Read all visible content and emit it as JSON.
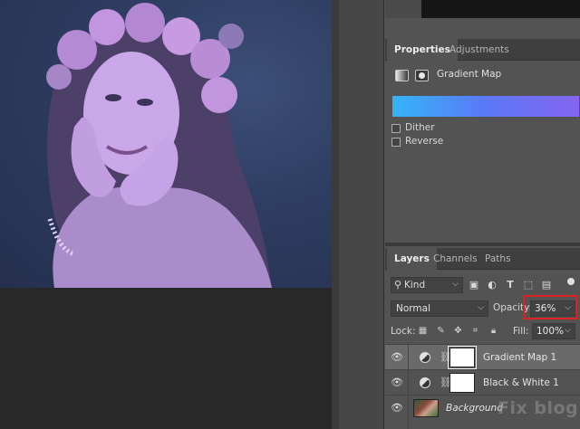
{
  "properties_panel": {
    "tabs": [
      "Properties",
      "Adjustments"
    ],
    "active_tab": "Properties",
    "title": "Gradient Map",
    "gradient_colors": [
      "#36b4f8",
      "#5b78f8",
      "#8666f0"
    ],
    "dither_label": "Dither",
    "dither_checked": false,
    "reverse_label": "Reverse",
    "reverse_checked": false
  },
  "layers_panel": {
    "tabs": [
      "Layers",
      "Channels",
      "Paths"
    ],
    "active_tab": "Layers",
    "filter_kind": "Kind",
    "filter_icons": [
      "image-filter-icon",
      "adjustment-filter-icon",
      "type-filter-icon",
      "shape-filter-icon",
      "smart-object-filter-icon"
    ],
    "blend_mode": "Normal",
    "opacity_label": "Opacity:",
    "opacity_value": "36%",
    "lock_label": "Lock:",
    "lock_icons": [
      "lock-transparent-icon",
      "lock-brush-icon",
      "lock-move-icon",
      "lock-artboard-icon",
      "lock-all-icon"
    ],
    "fill_label": "Fill:",
    "fill_value": "100%",
    "layers": [
      {
        "name": "Gradient Map 1",
        "type": "adjustment",
        "visible": true,
        "selected": true
      },
      {
        "name": "Black & White 1",
        "type": "adjustment",
        "visible": true,
        "selected": false
      },
      {
        "name": "Background",
        "type": "image",
        "visible": true,
        "selected": false
      }
    ]
  },
  "watermark": "Fix blog",
  "colors": {
    "highlight": "#e02020",
    "photo_tint": "#c6a4e8"
  }
}
